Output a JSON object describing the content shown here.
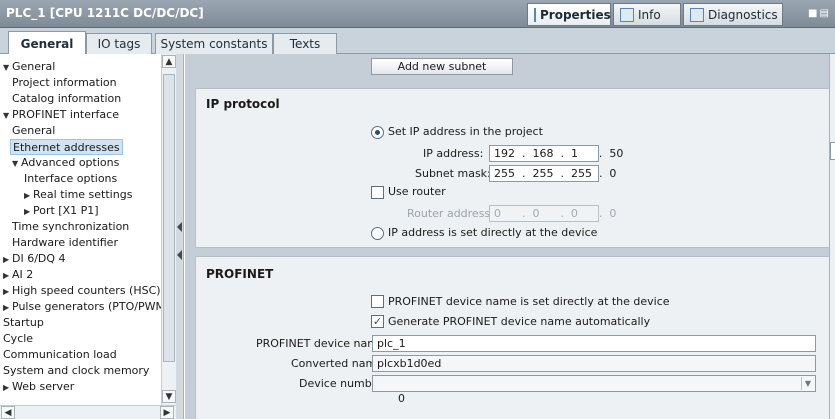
{
  "window": {
    "title": "PLC_1 [CPU 1211C DC/DC/DC]",
    "tabs": [
      {
        "label": "Properties",
        "active": true,
        "icon": "properties-icon"
      },
      {
        "label": "Info",
        "active": false,
        "icon": "info-icon"
      },
      {
        "label": "Diagnostics",
        "active": false,
        "icon": "diagnostics-icon"
      }
    ]
  },
  "subtabs": [
    {
      "label": "General",
      "active": true
    },
    {
      "label": "IO tags",
      "active": false
    },
    {
      "label": "System constants",
      "active": false
    },
    {
      "label": "Texts",
      "active": false
    }
  ],
  "tree": {
    "items": [
      {
        "label": "General",
        "caret": "▼"
      },
      {
        "label": "Project information"
      },
      {
        "label": "Catalog information"
      },
      {
        "label": "PROFINET interface",
        "caret": "▼"
      },
      {
        "label": "General"
      },
      {
        "label": "Ethernet addresses",
        "selected": true
      },
      {
        "label": "Advanced options",
        "caret": "▼"
      },
      {
        "label": "Interface options"
      },
      {
        "label": "Real time settings",
        "caret": "▶"
      },
      {
        "label": "Port [X1 P1]",
        "caret": "▶"
      },
      {
        "label": "Time synchronization"
      },
      {
        "label": "Hardware identifier"
      },
      {
        "label": "DI 6/DQ 4",
        "caret": "▶"
      },
      {
        "label": "AI 2",
        "caret": "▶"
      },
      {
        "label": "High speed counters (HSC)",
        "caret": "▶"
      },
      {
        "label": "Pulse generators (PTO/PWM)",
        "caret": "▶"
      },
      {
        "label": "Startup"
      },
      {
        "label": "Cycle"
      },
      {
        "label": "Communication load"
      },
      {
        "label": "System and clock memory"
      },
      {
        "label": "Web server",
        "caret": "▶"
      }
    ]
  },
  "content": {
    "add_subnet_label": "Add new subnet",
    "ip_protocol": {
      "heading": "IP protocol",
      "set_ip_label": "Set IP address in the project",
      "set_ip_selected": true,
      "ip_address_label": "IP address:",
      "ip_address_value": "192  .  168  .  1      .  50",
      "subnet_mask_label": "Subnet mask:",
      "subnet_mask_value": "255  .  255  .  255  .  0",
      "use_router_label": "Use router",
      "use_router_checked": false,
      "router_address_label": "Router address:",
      "router_address_value": "0      .  0      .  0      .  0",
      "ip_direct_label": "IP address is set directly at the device",
      "ip_direct_selected": false
    },
    "profinet": {
      "heading": "PROFINET",
      "name_direct_label": "PROFINET device name is set directly at the device",
      "name_direct_checked": false,
      "generate_name_label": "Generate PROFINET device name automatically",
      "generate_name_checked": true,
      "device_name_label": "PROFINET device name",
      "device_name_value": "plc_1",
      "converted_name_label": "Converted name:",
      "converted_name_value": "plcxb1d0ed",
      "device_number_label": "Device number:",
      "device_number_value": "0"
    }
  },
  "colors": {
    "titlebar": "#8996a2",
    "selection": "#cfe3f3",
    "content_bg": "#c5ced6",
    "section_bg": "#eef1f3"
  }
}
